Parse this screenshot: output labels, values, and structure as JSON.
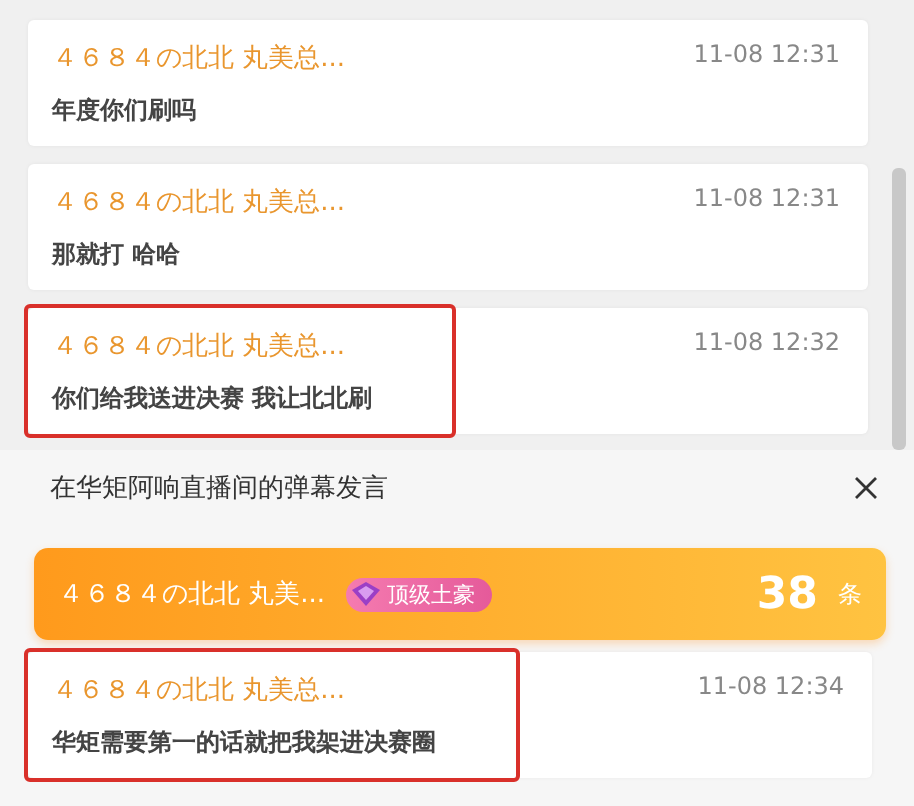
{
  "top_list": {
    "messages": [
      {
        "user": "４６８４の北北 丸美总...",
        "time": "11-08 12:31",
        "text": "年度你们刷吗",
        "highlighted": false
      },
      {
        "user": "４６８４の北北 丸美总...",
        "time": "11-08 12:31",
        "text": "那就打 哈哈",
        "highlighted": false
      },
      {
        "user": "４６８４の北北 丸美总...",
        "time": "11-08 12:32",
        "text": "你们给我送进决赛 我让北北刷",
        "highlighted": true
      }
    ]
  },
  "panel": {
    "title": "在华矩阿响直播间的弹幕发言",
    "summary": {
      "user": "４６８４の北北 丸美...",
      "badge": "顶级土豪",
      "count": "38",
      "unit": "条"
    },
    "messages": [
      {
        "user": "４６８４の北北 丸美总...",
        "time": "11-08 12:34",
        "text": "华矩需要第一的话就把我架进决赛圈",
        "highlighted": true
      }
    ]
  }
}
